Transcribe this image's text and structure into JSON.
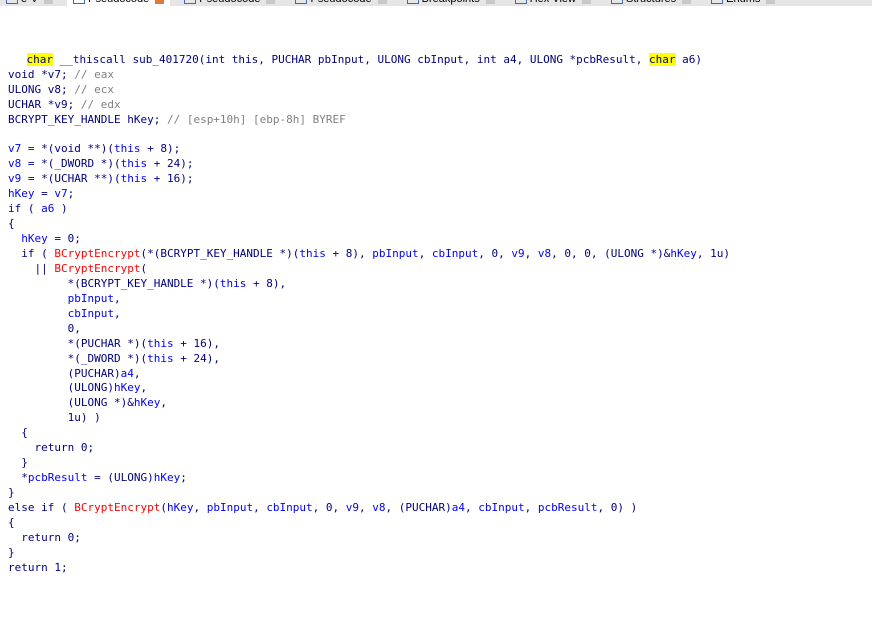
{
  "tabs": [
    {
      "label": "e-V",
      "active": false
    },
    {
      "label": "Pseudocode",
      "active": true
    },
    {
      "label": "Pseudocode",
      "active": false
    },
    {
      "label": "Pseudocode",
      "active": false
    },
    {
      "label": "Breakpoints",
      "active": false
    },
    {
      "label": "Hex View",
      "active": false
    },
    {
      "label": "Structures",
      "active": false
    },
    {
      "label": "Enums",
      "active": false
    }
  ],
  "signature": {
    "ret_type": "char",
    "rest_before": " __thiscall sub_401720(int this, PUCHAR pbInput, ULONG cbInput, int a4, ULONG *pcbResult, ",
    "arg_type": "char",
    "rest_after": " a6)"
  },
  "lines": [
    [
      [
        "n",
        "void *v7; "
      ],
      [
        "c",
        "// eax"
      ]
    ],
    [
      [
        "n",
        "ULONG v8; "
      ],
      [
        "c",
        "// ecx"
      ]
    ],
    [
      [
        "n",
        "UCHAR *v9; "
      ],
      [
        "c",
        "// edx"
      ]
    ],
    [
      [
        "n",
        "BCRYPT_KEY_HANDLE hKey; "
      ],
      [
        "c",
        "// [esp+10h] [ebp-8h] BYREF"
      ]
    ],
    [],
    [
      [
        "v",
        "v7"
      ],
      [
        "n",
        " = *(void **)("
      ],
      [
        "v",
        "this"
      ],
      [
        "n",
        " + 8);"
      ]
    ],
    [
      [
        "v",
        "v8"
      ],
      [
        "n",
        " = *(_DWORD *)("
      ],
      [
        "v",
        "this"
      ],
      [
        "n",
        " + 24);"
      ]
    ],
    [
      [
        "v",
        "v9"
      ],
      [
        "n",
        " = *(UCHAR **)("
      ],
      [
        "v",
        "this"
      ],
      [
        "n",
        " + 16);"
      ]
    ],
    [
      [
        "v",
        "hKey"
      ],
      [
        "n",
        " = "
      ],
      [
        "v",
        "v7"
      ],
      [
        "n",
        ";"
      ]
    ],
    [
      [
        "k",
        "if"
      ],
      [
        "n",
        " ( "
      ],
      [
        "v",
        "a6"
      ],
      [
        "n",
        " )"
      ]
    ],
    [
      [
        "n",
        "{"
      ]
    ],
    [
      [
        "n",
        "  "
      ],
      [
        "v",
        "hKey"
      ],
      [
        "n",
        " = 0;"
      ]
    ],
    [
      [
        "n",
        "  "
      ],
      [
        "k",
        "if"
      ],
      [
        "n",
        " ( "
      ],
      [
        "f",
        "BCryptEncrypt"
      ],
      [
        "n",
        "(*(BCRYPT_KEY_HANDLE *)("
      ],
      [
        "v",
        "this"
      ],
      [
        "n",
        " + 8), "
      ],
      [
        "v",
        "pbInput"
      ],
      [
        "n",
        ", "
      ],
      [
        "v",
        "cbInput"
      ],
      [
        "n",
        ", 0, "
      ],
      [
        "v",
        "v9"
      ],
      [
        "n",
        ", "
      ],
      [
        "v",
        "v8"
      ],
      [
        "n",
        ", 0, 0, (ULONG *)&"
      ],
      [
        "v",
        "hKey"
      ],
      [
        "n",
        ", 1u)"
      ]
    ],
    [
      [
        "n",
        "    || "
      ],
      [
        "f",
        "BCryptEncrypt"
      ],
      [
        "n",
        "("
      ]
    ],
    [
      [
        "n",
        "         *(BCRYPT_KEY_HANDLE *)("
      ],
      [
        "v",
        "this"
      ],
      [
        "n",
        " + 8),"
      ]
    ],
    [
      [
        "n",
        "         "
      ],
      [
        "v",
        "pbInput"
      ],
      [
        "n",
        ","
      ]
    ],
    [
      [
        "n",
        "         "
      ],
      [
        "v",
        "cbInput"
      ],
      [
        "n",
        ","
      ]
    ],
    [
      [
        "n",
        "         0,"
      ]
    ],
    [
      [
        "n",
        "         *(PUCHAR *)("
      ],
      [
        "v",
        "this"
      ],
      [
        "n",
        " + 16),"
      ]
    ],
    [
      [
        "n",
        "         *(_DWORD *)("
      ],
      [
        "v",
        "this"
      ],
      [
        "n",
        " + 24),"
      ]
    ],
    [
      [
        "n",
        "         (PUCHAR)"
      ],
      [
        "v",
        "a4"
      ],
      [
        "n",
        ","
      ]
    ],
    [
      [
        "n",
        "         (ULONG)"
      ],
      [
        "v",
        "hKey"
      ],
      [
        "n",
        ","
      ]
    ],
    [
      [
        "n",
        "         (ULONG *)&"
      ],
      [
        "v",
        "hKey"
      ],
      [
        "n",
        ","
      ]
    ],
    [
      [
        "n",
        "         1u) )"
      ]
    ],
    [
      [
        "n",
        "  {"
      ]
    ],
    [
      [
        "n",
        "    "
      ],
      [
        "k",
        "return"
      ],
      [
        "n",
        " 0;"
      ]
    ],
    [
      [
        "n",
        "  }"
      ]
    ],
    [
      [
        "n",
        "  *"
      ],
      [
        "v",
        "pcbResult"
      ],
      [
        "n",
        " = (ULONG)"
      ],
      [
        "v",
        "hKey"
      ],
      [
        "n",
        ";"
      ]
    ],
    [
      [
        "n",
        "}"
      ]
    ],
    [
      [
        "k",
        "else if"
      ],
      [
        "n",
        " ( "
      ],
      [
        "f",
        "BCryptEncrypt"
      ],
      [
        "n",
        "("
      ],
      [
        "v",
        "hKey"
      ],
      [
        "n",
        ", "
      ],
      [
        "v",
        "pbInput"
      ],
      [
        "n",
        ", "
      ],
      [
        "v",
        "cbInput"
      ],
      [
        "n",
        ", 0, "
      ],
      [
        "v",
        "v9"
      ],
      [
        "n",
        ", "
      ],
      [
        "v",
        "v8"
      ],
      [
        "n",
        ", (PUCHAR)"
      ],
      [
        "v",
        "a4"
      ],
      [
        "n",
        ", "
      ],
      [
        "v",
        "cbInput"
      ],
      [
        "n",
        ", "
      ],
      [
        "v",
        "pcbResult"
      ],
      [
        "n",
        ", 0) )"
      ]
    ],
    [
      [
        "n",
        "{"
      ]
    ],
    [
      [
        "n",
        "  "
      ],
      [
        "k",
        "return"
      ],
      [
        "n",
        " 0;"
      ]
    ],
    [
      [
        "n",
        "}"
      ]
    ],
    [
      [
        "k",
        "return"
      ],
      [
        "n",
        " 1;"
      ]
    ]
  ]
}
